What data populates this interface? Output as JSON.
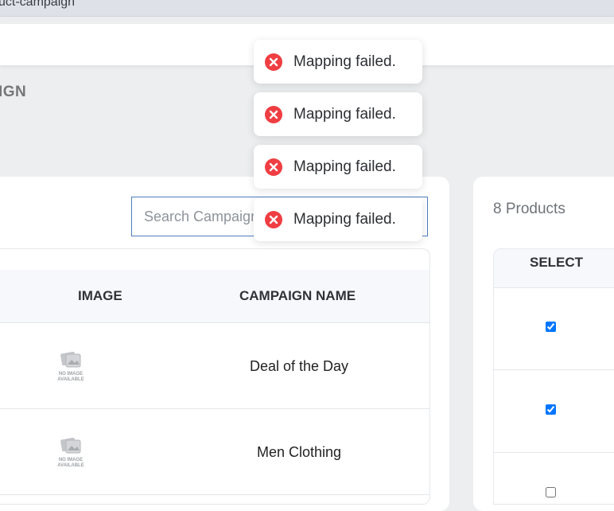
{
  "browser": {
    "url_fragment": "uct-campaign"
  },
  "page": {
    "title": "IGN"
  },
  "search": {
    "placeholder": "Search Campaign"
  },
  "table": {
    "headers": {
      "image": "IMAGE",
      "campaign_name": "CAMPAIGN NAME"
    },
    "rows": [
      {
        "image_label": "NO IMAGE AVAILABLE",
        "name": "Deal of the Day"
      },
      {
        "image_label": "NO IMAGE AVAILABLE",
        "name": "Men Clothing"
      }
    ]
  },
  "products": {
    "count_label": "8 Products",
    "select_header": "SELECT",
    "rows": [
      {
        "checked": true
      },
      {
        "checked": true
      },
      {
        "checked": false
      }
    ]
  },
  "toasts": [
    {
      "icon": "error-icon",
      "message": "Mapping failed."
    },
    {
      "icon": "error-icon",
      "message": "Mapping failed."
    },
    {
      "icon": "error-icon",
      "message": "Mapping failed."
    },
    {
      "icon": "error-icon",
      "message": "Mapping failed."
    }
  ],
  "colors": {
    "error": "#ef3e42",
    "search_border": "#4d7ec0",
    "checkbox": "#1a73e8"
  }
}
